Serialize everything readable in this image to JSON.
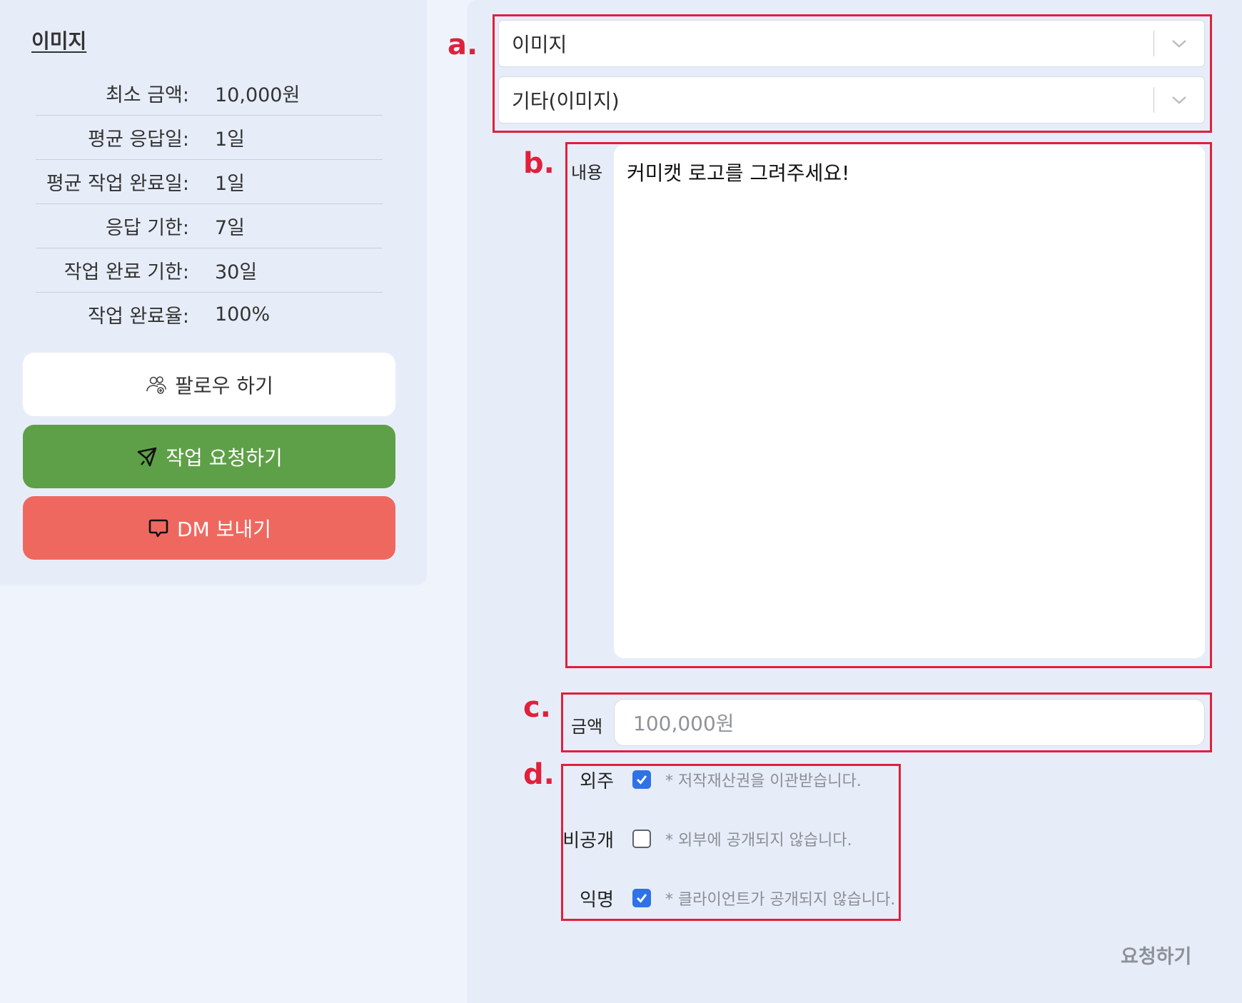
{
  "left": {
    "title": "이미지",
    "stats": [
      {
        "label": "최소 금액:",
        "value": "10,000원"
      },
      {
        "label": "평균 응답일:",
        "value": "1일"
      },
      {
        "label": "평균 작업 완료일:",
        "value": "1일"
      },
      {
        "label": "응답 기한:",
        "value": "7일"
      },
      {
        "label": "작업 완료 기한:",
        "value": "30일"
      },
      {
        "label": "작업 완료율:",
        "value": "100%"
      }
    ],
    "buttons": {
      "follow": "팔로우 하기",
      "request": "작업 요청하기",
      "dm": "DM 보내기"
    }
  },
  "form": {
    "category": "이미지",
    "subcategory": "기타(이미지)",
    "content_label": "내용",
    "content_value": "커미캣 로고를 그려주세요!",
    "amount_label": "금액",
    "amount_placeholder": "100,000원",
    "options": [
      {
        "label": "외주",
        "checked": true,
        "note": "* 저작재산권을 이관받습니다."
      },
      {
        "label": "비공개",
        "checked": false,
        "note": "* 외부에 공개되지 않습니다."
      },
      {
        "label": "익명",
        "checked": true,
        "note": "* 클라이언트가 공개되지 않습니다."
      }
    ],
    "submit": "요청하기"
  },
  "annotations": {
    "a": "a.",
    "b": "b.",
    "c": "c.",
    "d": "d."
  },
  "colors": {
    "annotation": "#e0203c",
    "request_button": "#5ea047",
    "dm_button": "#ef685f",
    "checkbox": "#2e72e6"
  }
}
